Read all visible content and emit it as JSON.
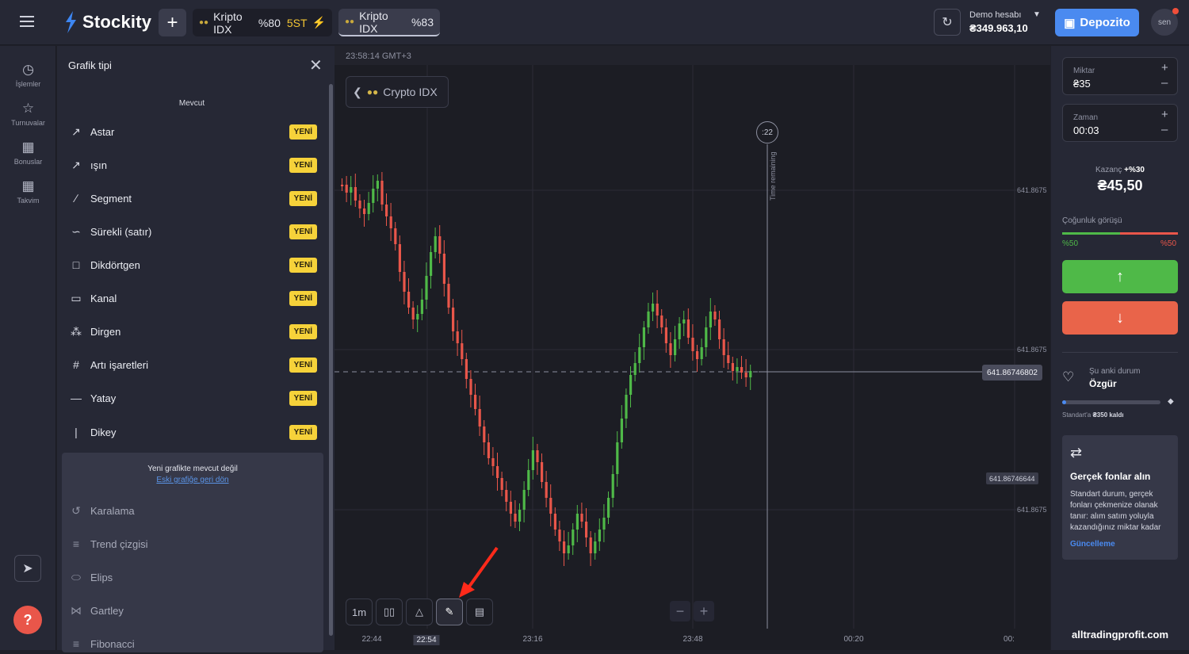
{
  "header": {
    "brand": "Stockity",
    "add_label": "+",
    "tabs": [
      {
        "name": "Kripto IDX",
        "payout": "%80",
        "extra": "5ST"
      },
      {
        "name": "Kripto IDX",
        "payout": "%83"
      }
    ],
    "account_type": "Demo hesabı",
    "balance": "₴349.963,10",
    "deposit_label": "Depozito",
    "avatar_text": "sen"
  },
  "sidebar": {
    "items": [
      {
        "label": "İşlemler",
        "icon": "clock-icon"
      },
      {
        "label": "Turnuvalar",
        "icon": "trophy-icon"
      },
      {
        "label": "Bonuslar",
        "icon": "gift-icon"
      },
      {
        "label": "Takvim",
        "icon": "calendar-icon"
      }
    ]
  },
  "drawing_panel": {
    "title": "Grafik tipi",
    "section_available": "Mevcut",
    "badge": "YENİ",
    "tools": [
      {
        "label": "Astar",
        "icon": "ray-icon"
      },
      {
        "label": "ışın",
        "icon": "ray-icon"
      },
      {
        "label": "Segment",
        "icon": "segment-icon"
      },
      {
        "label": "Sürekli (satır)",
        "icon": "polyline-icon"
      },
      {
        "label": "Dikdörtgen",
        "icon": "rectangle-icon"
      },
      {
        "label": "Kanal",
        "icon": "channel-icon"
      },
      {
        "label": "Dirgen",
        "icon": "pitchfork-icon"
      },
      {
        "label": "Artı işaretleri",
        "icon": "crosshair-icon"
      },
      {
        "label": "Yatay",
        "icon": "horizontal-line-icon"
      },
      {
        "label": "Dikey",
        "icon": "vertical-line-icon"
      }
    ],
    "unavailable_title": "Yeni grafikte mevcut değil",
    "unavailable_link": "Eski grafiğe geri dön",
    "unavailable_tools": [
      {
        "label": "Karalama",
        "icon": "scribble-icon"
      },
      {
        "label": "Trend çizgisi",
        "icon": "trend-line-icon"
      },
      {
        "label": "Elips",
        "icon": "ellipse-icon"
      },
      {
        "label": "Gartley",
        "icon": "gartley-icon"
      },
      {
        "label": "Fibonacci",
        "icon": "fibonacci-icon"
      }
    ]
  },
  "chart": {
    "server_time": "23:58:14 GMT+3",
    "asset_label": "Crypto IDX",
    "timer": ":22",
    "time_remaining_label": "Time remaining",
    "timeframe": "1m",
    "current_price": "641.86746802",
    "marker_price": "641.86746644",
    "x_labels": [
      "22:44",
      "22:54",
      "23:16",
      "23:48",
      "00:20",
      "00:"
    ],
    "y_labels": [
      "641.8675",
      "641.8675",
      "641.8675"
    ],
    "zoom_out": "−",
    "zoom_in": "+"
  },
  "trade": {
    "amount_label": "Miktar",
    "amount_value": "₴35",
    "time_label": "Zaman",
    "time_value": "00:03",
    "profit_label": "Kazanç",
    "profit_pct": "+%30",
    "profit_value": "₴45,50",
    "sentiment_label": "Çoğunluk görüşü",
    "sentiment_up": "%50",
    "sentiment_down": "%50",
    "sentiment_up_fraction": 0.5,
    "up_icon": "arrow-up-icon",
    "down_icon": "arrow-down-icon"
  },
  "status": {
    "label": "Şu anki durum",
    "value": "Özgür",
    "progress_fraction": 0.04,
    "next_prefix": "Standart'a",
    "next_amount": "₴350 kaldı"
  },
  "promo": {
    "title": "Gerçek fonlar alın",
    "text": "Standart durum, gerçek fonları çekmenize olanak tanır: alım satım yoluyla kazandığınız miktar kadar",
    "link": "Güncelleme"
  },
  "watermark": "alltradingprofit.com",
  "colors": {
    "up": "#4fb948",
    "down": "#e9564a",
    "accent": "#4a8af0",
    "badge": "#f6d23a"
  }
}
